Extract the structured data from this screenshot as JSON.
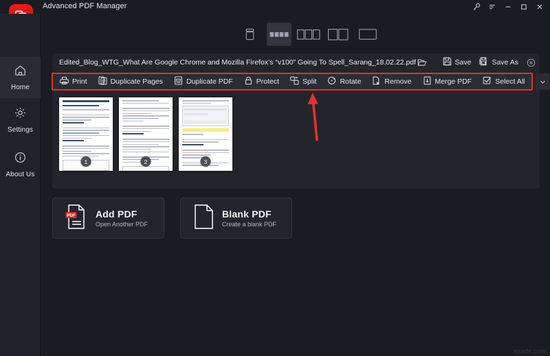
{
  "window": {
    "title": "Advanced PDF Manager",
    "logo_icon": "pdf-pages-logo",
    "controls": [
      {
        "name": "key-icon",
        "label": "⚷"
      },
      {
        "name": "menu-icon",
        "label": "≡"
      },
      {
        "name": "minimize-icon",
        "label": "–"
      },
      {
        "name": "maximize-icon",
        "label": "□"
      },
      {
        "name": "close-icon",
        "label": "✕"
      }
    ]
  },
  "sidebar": {
    "items": [
      {
        "label": "Home",
        "icon": "home-icon",
        "active": true
      },
      {
        "label": "Settings",
        "icon": "gear-icon",
        "active": false
      },
      {
        "label": "About Us",
        "icon": "info-icon",
        "active": false
      }
    ]
  },
  "view_modes": [
    {
      "name": "single-scroll-view",
      "selected": false
    },
    {
      "name": "grid-four-up-view",
      "selected": true
    },
    {
      "name": "three-up-view",
      "selected": false
    },
    {
      "name": "two-up-view",
      "selected": false
    },
    {
      "name": "one-up-view",
      "selected": false
    }
  ],
  "file": {
    "name": "Edited_Blog_WTG_What Are Google Chrome and Mozilla Firefox’s “v100” Going To Spell_Sarang_18.02.22.pdf",
    "open_icon": "open-folder-icon",
    "save_label": "Save",
    "save_icon": "save-disk-icon",
    "save_as_label": "Save As",
    "save_as_icon": "save-as-icon",
    "close_document_icon": "close-document-icon"
  },
  "toolbar": {
    "highlight_color": "#e8302c",
    "items": [
      {
        "label": "Print",
        "icon": "printer-icon"
      },
      {
        "label": "Duplicate Pages",
        "icon": "duplicate-pages-icon"
      },
      {
        "label": "Duplicate PDF",
        "icon": "duplicate-pdf-icon"
      },
      {
        "label": "Protect",
        "icon": "lock-icon"
      },
      {
        "label": "Split",
        "icon": "split-icon"
      },
      {
        "label": "Rotate",
        "icon": "rotate-icon"
      },
      {
        "label": "Remove",
        "icon": "remove-file-icon"
      },
      {
        "label": "Merge PDF",
        "icon": "merge-pdf-icon"
      },
      {
        "label": "Select All",
        "icon": "checkbox-check-icon"
      }
    ],
    "overflow_icon": "chevron-down-icon"
  },
  "pages": [
    {
      "number": "1",
      "type": "text-heading"
    },
    {
      "number": "2",
      "type": "text"
    },
    {
      "number": "3",
      "type": "screenshot-highlight"
    }
  ],
  "cards": [
    {
      "title": "Add PDF",
      "subtitle": "Open Another PDF",
      "icon": "pdf-file-icon"
    },
    {
      "title": "Blank PDF",
      "subtitle": "Create a blank PDF",
      "icon": "blank-page-icon"
    }
  ],
  "annotation": {
    "arrow_color": "#e8302c",
    "points_to": "Split"
  },
  "watermark": "wsxdn.com"
}
